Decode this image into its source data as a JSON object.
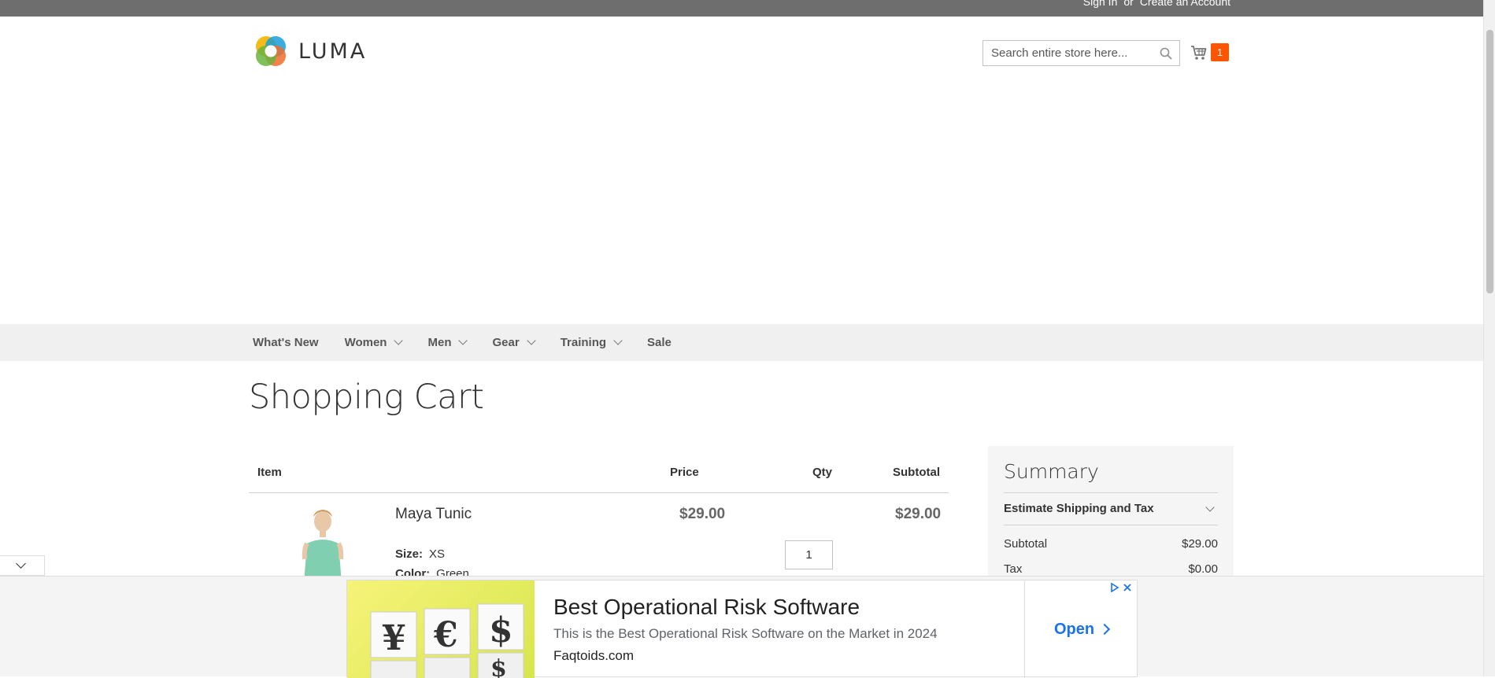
{
  "header": {
    "sign_in": "Sign In",
    "or": "or",
    "create_account": "Create an Account",
    "logo_text": "LUMA",
    "search_placeholder": "Search entire store here...",
    "cart_count": "1"
  },
  "nav": {
    "items": [
      {
        "label": "What's New",
        "has_dropdown": false
      },
      {
        "label": "Women",
        "has_dropdown": true
      },
      {
        "label": "Men",
        "has_dropdown": true
      },
      {
        "label": "Gear",
        "has_dropdown": true
      },
      {
        "label": "Training",
        "has_dropdown": true
      },
      {
        "label": "Sale",
        "has_dropdown": false
      }
    ]
  },
  "page": {
    "title": "Shopping Cart"
  },
  "cart": {
    "columns": [
      "Item",
      "Price",
      "Qty",
      "Subtotal"
    ],
    "items": [
      {
        "name": "Maya Tunic",
        "price": "$29.00",
        "qty": "1",
        "subtotal": "$29.00",
        "options": [
          {
            "label": "Size:",
            "value": "XS"
          },
          {
            "label": "Color:",
            "value": "Green"
          }
        ]
      }
    ]
  },
  "summary": {
    "title": "Summary",
    "estimate_label": "Estimate Shipping and Tax",
    "lines": [
      {
        "label": "Subtotal",
        "value": "$29.00"
      },
      {
        "label": "Tax",
        "value": "$0.00"
      }
    ]
  },
  "ad": {
    "headline": "Best Operational Risk Software",
    "description": "This is the Best Operational Risk Software on the Market in 2024",
    "domain": "Faqtoids.com",
    "cta": "Open"
  },
  "colors": {
    "topbar": "#6e6e6e",
    "badge": "#ff5501",
    "nav_bg": "#f0f0f0",
    "summary_bg": "#f5f5f5",
    "ad_link": "#1a73e8"
  }
}
